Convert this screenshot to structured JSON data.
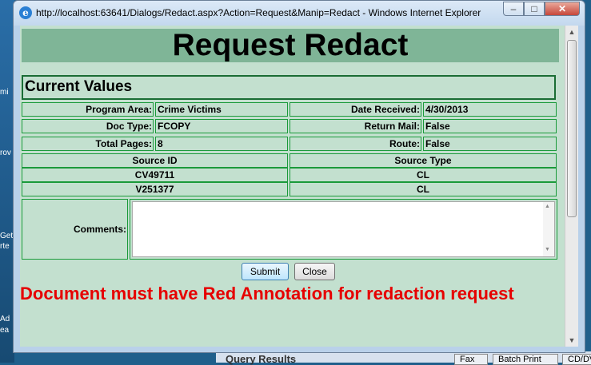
{
  "desktop": {
    "labels": [
      "mi",
      "rov",
      "Get",
      "rte",
      "Ad",
      "ea"
    ],
    "bottom_text": "Query Results",
    "taskbar_buttons": [
      "Fax",
      "Batch Print",
      "CD/DVD"
    ]
  },
  "window": {
    "title": "http://localhost:63641/Dialogs/Redact.aspx?Action=Request&Manip=Redact - Windows Internet Explorer",
    "icon": "ie-icon",
    "min_glyph": "‒",
    "max_glyph": "□",
    "close_glyph": "✕"
  },
  "page": {
    "heading": "Request Redact",
    "current_values_title": "Current Values",
    "fields": {
      "program_area_label": "Program Area:",
      "program_area_value": "Crime Victims",
      "date_received_label": "Date Received:",
      "date_received_value": "4/30/2013",
      "doc_type_label": "Doc Type:",
      "doc_type_value": "FCOPY",
      "return_mail_label": "Return Mail:",
      "return_mail_value": "False",
      "total_pages_label": "Total Pages:",
      "total_pages_value": "8",
      "route_label": "Route:",
      "route_value": "False"
    },
    "sources": {
      "headers": [
        "Source ID",
        "Source Type"
      ],
      "rows": [
        [
          "CV49711",
          "CL"
        ],
        [
          "V251377",
          "CL"
        ]
      ]
    },
    "comments_label": "Comments:",
    "comments_value": "",
    "submit_label": "Submit",
    "close_label": "Close",
    "error_message": "Document must have Red Annotation for redaction request"
  },
  "colors": {
    "page_bg": "#c3e0cf",
    "heading_bg": "#7fb597",
    "cell_border": "#1a9a3a",
    "error": "#e60000"
  }
}
